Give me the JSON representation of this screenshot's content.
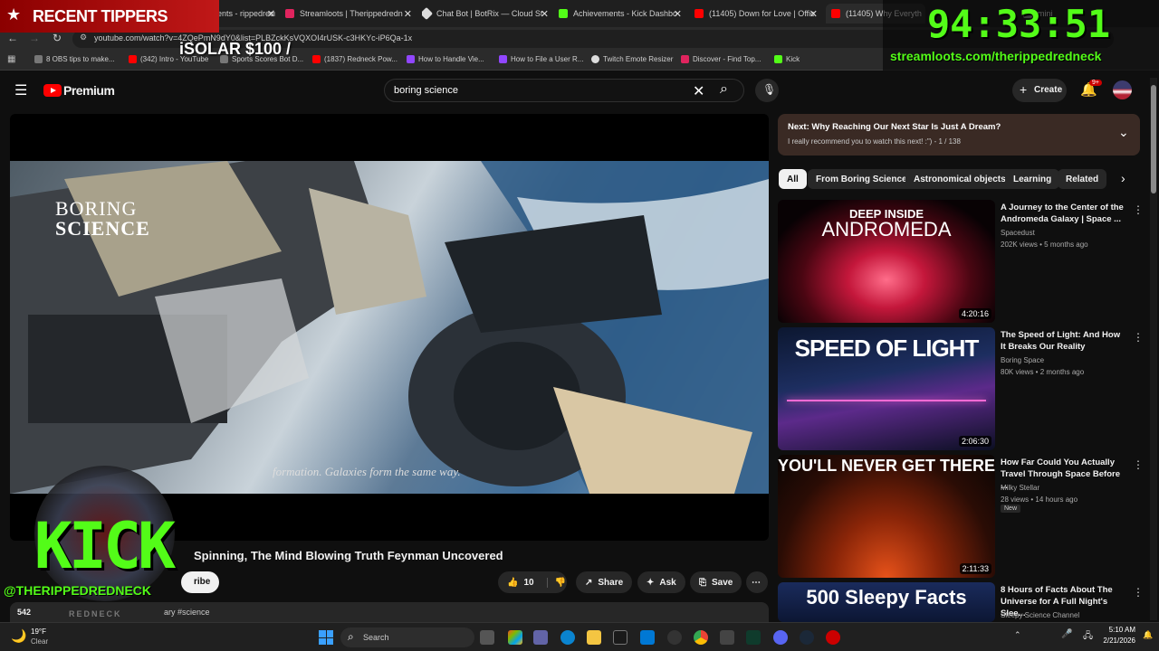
{
  "tabs": [
    {
      "label": "Stream Elements - rippedredn",
      "color": "#cc2c2c"
    },
    {
      "label": "Streamloots | Therippedredn",
      "color": "#e0245e"
    },
    {
      "label": "Chat Bot | BotRix — Cloud St",
      "color": "#dddddd"
    },
    {
      "label": "Achievements - Kick Dashbo",
      "color": "#53fc18"
    },
    {
      "label": "(11405) Down for Love | Offic",
      "color": "#ff0000"
    },
    {
      "label": "(11405) Why Everyth",
      "color": "#ff0000"
    },
    {
      "label": "mini",
      "color": "#888888"
    }
  ],
  "address": {
    "url": "youtube.com/watch?v=4ZQePmN9dY0&list=PLBZckKsVQXOI4rUSK-c3HKYc-iP6Qa-1x"
  },
  "bookmarks": [
    {
      "label": "8 OBS tips to make...",
      "color": "#777"
    },
    {
      "label": "(342) Intro - YouTube",
      "color": "#ff0000"
    },
    {
      "label": "Sports Scores Bot D...",
      "color": "#777"
    },
    {
      "label": "(1837) Redneck Pow...",
      "color": "#ff0000"
    },
    {
      "label": "How to Handle Vie...",
      "color": "#9146ff"
    },
    {
      "label": "How to File a User R...",
      "color": "#9146ff"
    },
    {
      "label": "Twitch Emote Resizer",
      "color": "#ddd"
    },
    {
      "label": "Discover - Find Top...",
      "color": "#e0245e"
    },
    {
      "label": "Kick",
      "color": "#53fc18"
    }
  ],
  "overlay": {
    "recent_tippers": "RECENT TIPPERS",
    "tip": "iSOLAR $100 /",
    "timer": "94:33:51",
    "streamloots_url": "streamloots.com/therippedredneck",
    "kick_logo": "KICK",
    "kick_handle": "@THERIPPEDREDNECK",
    "kick_sub": "REDNECK"
  },
  "yt": {
    "brand": "Premium",
    "search_value": "boring science",
    "create_label": "Create",
    "notif_count": "9+"
  },
  "video": {
    "brand_line1": "BORING",
    "brand_line2": "SCIENCE",
    "subtitle": "formation. Galaxies form the same way.",
    "title": "Spinning, The Mind Blowing Truth Feynman Uncovered",
    "subscribe": "ribe",
    "views": "542",
    "desc": "ary #science",
    "likes": "10",
    "share": "Share",
    "ask": "Ask",
    "save": "Save"
  },
  "playlist": {
    "next": "Next: Why Reaching Our Next Star Is Just A Dream?",
    "sub": "I really recommend you to watch this next! :\") - 1 / 138"
  },
  "chips": [
    "All",
    "From Boring Science",
    "Astronomical objects",
    "Learning",
    "Related"
  ],
  "recs": [
    {
      "title": "A Journey to the Center of the Andromeda Galaxy | Space ...",
      "channel": "Spacedust",
      "stats": "202K views • 5 months ago",
      "duration": "4:20:16",
      "thumb_text": "DEEP INSIDE",
      "thumb_text2": "ANDROMEDA",
      "badge": ""
    },
    {
      "title": "The Speed of Light: And How It Breaks Our Reality",
      "channel": "Boring Space",
      "stats": "80K views • 2 months ago",
      "duration": "2:06:30",
      "thumb_text": "SPEED OF LIGHT",
      "thumb_text2": "",
      "badge": ""
    },
    {
      "title": "How Far Could You Actually Travel Through Space Before ...",
      "channel": "Milky Stellar",
      "stats": "28 views • 14 hours ago",
      "duration": "2:11:33",
      "thumb_text": "YOU'LL NEVER GET THERE",
      "thumb_text2": "",
      "badge": "New"
    },
    {
      "title": "8 Hours of Facts About The Universe for A Full Night's Slee...",
      "channel": "Sleepy Science Channel",
      "stats": "",
      "duration": "",
      "thumb_text": "500 Sleepy Facts",
      "thumb_text2": "",
      "badge": ""
    }
  ],
  "taskbar": {
    "temp": "19°F",
    "cond": "Clear",
    "search": "Search",
    "time": "5:10 AM",
    "date": "2/21/2026"
  }
}
